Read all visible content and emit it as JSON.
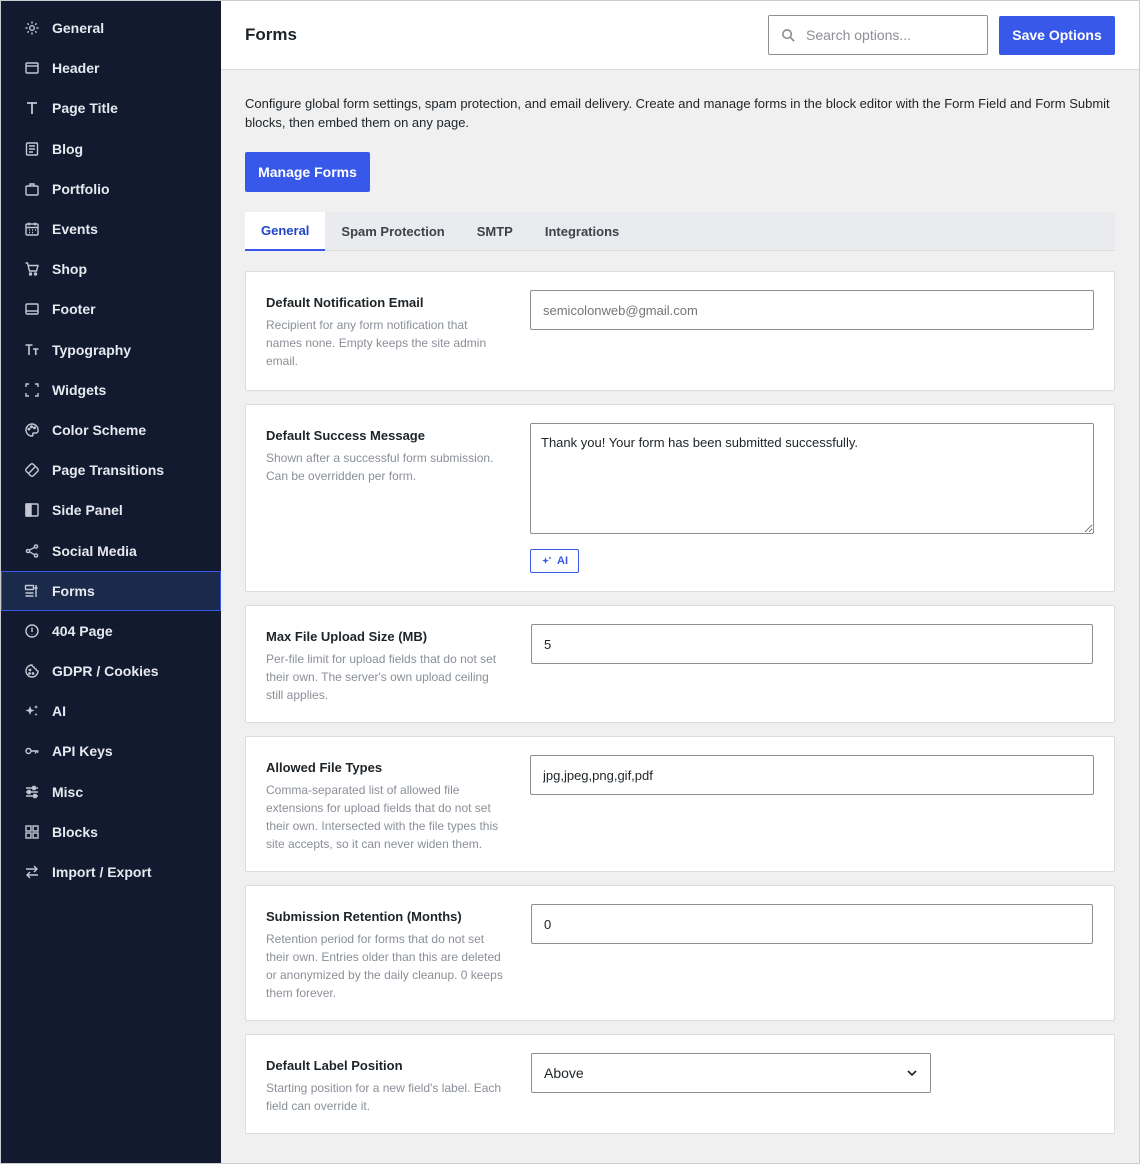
{
  "sidebar": {
    "items": [
      {
        "label": "General",
        "icon": "gear-icon"
      },
      {
        "label": "Header",
        "icon": "header-icon"
      },
      {
        "label": "Page Title",
        "icon": "title-icon"
      },
      {
        "label": "Blog",
        "icon": "blog-icon"
      },
      {
        "label": "Portfolio",
        "icon": "briefcase-icon"
      },
      {
        "label": "Events",
        "icon": "calendar-icon"
      },
      {
        "label": "Shop",
        "icon": "cart-icon"
      },
      {
        "label": "Footer",
        "icon": "footer-icon"
      },
      {
        "label": "Typography",
        "icon": "typography-icon"
      },
      {
        "label": "Widgets",
        "icon": "widgets-icon"
      },
      {
        "label": "Color Scheme",
        "icon": "palette-icon"
      },
      {
        "label": "Page Transitions",
        "icon": "transition-icon"
      },
      {
        "label": "Side Panel",
        "icon": "side-panel-icon"
      },
      {
        "label": "Social Media",
        "icon": "share-icon"
      },
      {
        "label": "Forms",
        "icon": "forms-icon",
        "active": true
      },
      {
        "label": "404 Page",
        "icon": "404-icon"
      },
      {
        "label": "GDPR / Cookies",
        "icon": "cookie-icon"
      },
      {
        "label": "AI",
        "icon": "sparkle-icon"
      },
      {
        "label": "API Keys",
        "icon": "key-icon"
      },
      {
        "label": "Misc",
        "icon": "sliders-icon"
      },
      {
        "label": "Blocks",
        "icon": "blocks-icon"
      },
      {
        "label": "Import / Export",
        "icon": "arrows-icon"
      }
    ]
  },
  "header": {
    "title": "Forms",
    "search_placeholder": "Search options...",
    "save_label": "Save Options"
  },
  "main": {
    "intro": "Configure global form settings, spam protection, and email delivery. Create and manage forms in the block editor with the Form Field and Form Submit blocks, then embed them on any page.",
    "manage_label": "Manage Forms",
    "tabs": [
      {
        "label": "General",
        "active": true
      },
      {
        "label": "Spam Protection"
      },
      {
        "label": "SMTP"
      },
      {
        "label": "Integrations"
      }
    ],
    "settings": {
      "notification_email": {
        "label": "Default Notification Email",
        "desc": "Recipient for any form notification that names none. Empty keeps the site admin email.",
        "placeholder": "semicolonweb@gmail.com"
      },
      "success_message": {
        "label": "Default Success Message",
        "desc": "Shown after a successful form submission. Can be overridden per form.",
        "value": "Thank you! Your form has been submitted successfully.",
        "ai_label": "AI"
      },
      "max_upload": {
        "label": "Max File Upload Size (MB)",
        "desc": "Per-file limit for upload fields that do not set their own. The server's own upload ceiling still applies.",
        "value": "5"
      },
      "file_types": {
        "label": "Allowed File Types",
        "desc": "Comma-separated list of allowed file extensions for upload fields that do not set their own. Intersected with the file types this site accepts, so it can never widen them.",
        "value": "jpg,jpeg,png,gif,pdf"
      },
      "retention": {
        "label": "Submission Retention (Months)",
        "desc": "Retention period for forms that do not set their own. Entries older than this are deleted or anonymized by the daily cleanup. 0 keeps them forever.",
        "value": "0"
      },
      "label_position": {
        "label": "Default Label Position",
        "desc": "Starting position for a new field's label. Each field can override it.",
        "value": "Above"
      }
    }
  }
}
